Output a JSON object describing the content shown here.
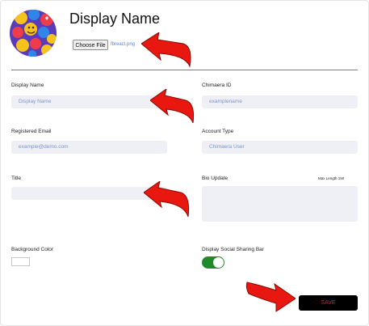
{
  "header": {
    "title": "Display Name",
    "choose_file_label": "Choose File",
    "file_name": "fbreact.png"
  },
  "form": {
    "display_name": {
      "label": "Display Name",
      "placeholder": "Display Name"
    },
    "chimaera_id": {
      "label": "Chimaera ID",
      "placeholder": "examplename"
    },
    "registered_email": {
      "label": "Registered Email",
      "placeholder": "example@demo.com"
    },
    "account_type": {
      "label": "Account Type",
      "value": "Chimaera User"
    },
    "title": {
      "label": "Title",
      "value": ""
    },
    "bio": {
      "label": "Bio Update",
      "max_length_label": "Max Length 150",
      "value": ""
    },
    "background_color": {
      "label": "Background Color",
      "value": "#ffffff"
    },
    "social_sharing": {
      "label": "Display Social Sharing Bar",
      "enabled": true
    }
  },
  "actions": {
    "save_label": "SAVE"
  },
  "colors": {
    "accent_arrow": "#e8170f",
    "toggle_on": "#1f8a2a",
    "save_text": "#e02020",
    "field_bg": "#eef0f6"
  },
  "icons": [
    "avatar-emoji-reactions",
    "red-arrow-icon"
  ]
}
